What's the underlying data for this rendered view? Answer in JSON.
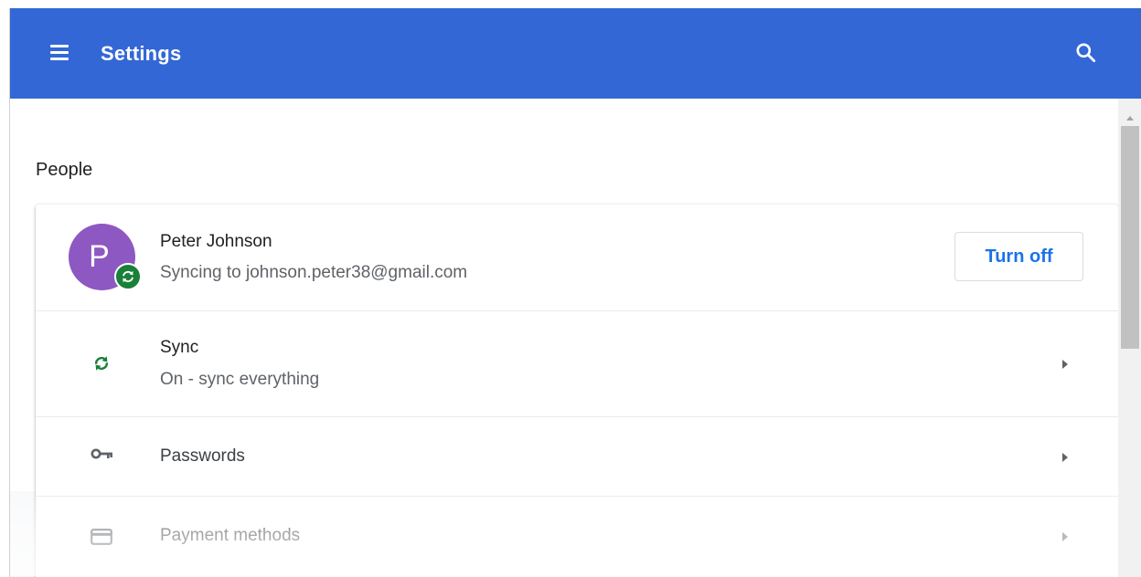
{
  "header": {
    "title": "Settings",
    "menu_icon": "hamburger-menu-icon",
    "search_icon": "search-icon",
    "background": "#3367d6"
  },
  "people": {
    "section_title": "People",
    "account": {
      "avatar_letter": "P",
      "avatar_color": "#8e58c2",
      "name": "Peter Johnson",
      "status": "Syncing to johnson.peter38@gmail.com",
      "turn_off_label": "Turn off",
      "badge_icon": "sync-icon"
    },
    "rows": [
      {
        "icon": "sync-icon",
        "label": "Sync",
        "sublabel": "On - sync everything"
      },
      {
        "icon": "key-icon",
        "label": "Passwords"
      },
      {
        "icon": "credit-card-icon",
        "label": "Payment methods"
      }
    ]
  },
  "colors": {
    "accent": "#1a73e8",
    "sync_green": "#188038"
  }
}
